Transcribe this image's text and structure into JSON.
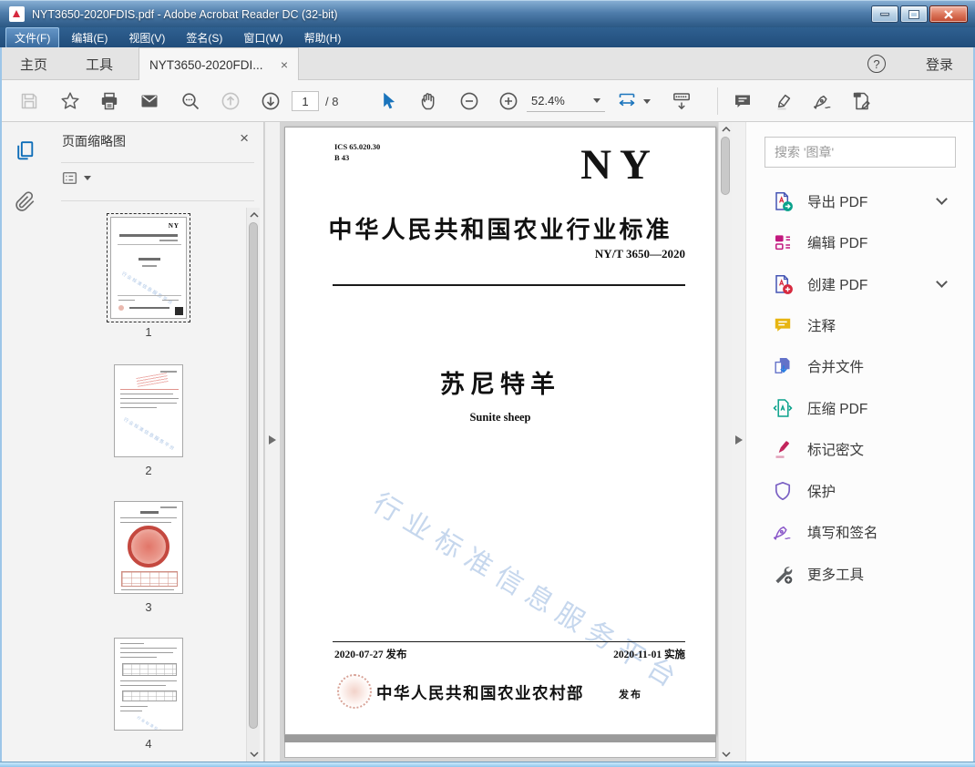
{
  "window": {
    "title": "NYT3650-2020FDIS.pdf - Adobe Acrobat Reader DC (32-bit)"
  },
  "menu": {
    "items": [
      "文件(F)",
      "编辑(E)",
      "视图(V)",
      "签名(S)",
      "窗口(W)",
      "帮助(H)"
    ]
  },
  "tabbar": {
    "home": "主页",
    "tools": "工具",
    "document_tab": "NYT3650-2020FDI...",
    "close_tab": "×",
    "help": "?",
    "sign_in": "登录"
  },
  "toolbar": {
    "page_current": "1",
    "page_total": "/ 8",
    "zoom_value": "52.4%"
  },
  "left_panel": {
    "title": "页面缩略图",
    "close": "×",
    "thumbnails": [
      {
        "number": "1"
      },
      {
        "number": "2"
      },
      {
        "number": "3"
      },
      {
        "number": "4"
      }
    ]
  },
  "document": {
    "ics_line1": "ICS 65.020.30",
    "ics_line2": "B 43",
    "logo": "NY",
    "standard_title": "中华人民共和国农业行业标准",
    "standard_number": "NY/T 3650—2020",
    "doc_title_cn": "苏尼特羊",
    "doc_title_en": "Sunite sheep",
    "watermark": "行业标准信息服务平台",
    "issue_date": "2020-07-27 发布",
    "implement_date": "2020-11-01 实施",
    "publisher": "中华人民共和国农业农村部",
    "publish_suffix": "发布"
  },
  "right_panel": {
    "search_placeholder": "搜索 '图章'",
    "tools": [
      {
        "label": "导出 PDF",
        "expandable": true
      },
      {
        "label": "编辑 PDF",
        "expandable": false
      },
      {
        "label": "创建 PDF",
        "expandable": true
      },
      {
        "label": "注释",
        "expandable": false
      },
      {
        "label": "合并文件",
        "expandable": false
      },
      {
        "label": "压缩 PDF",
        "expandable": false
      },
      {
        "label": "标记密文",
        "expandable": false
      },
      {
        "label": "保护",
        "expandable": false
      },
      {
        "label": "填写和签名",
        "expandable": false
      },
      {
        "label": "更多工具",
        "expandable": false
      }
    ]
  },
  "colors": {
    "accent_blue": "#1a74bc",
    "titlebar_blue": "#3b6ea2",
    "watermark_blue": "#bdd1eb",
    "seal_red": "#c0392f",
    "export_badge_teal": "#0aa18b",
    "edit_magenta": "#c2187e",
    "comment_yellow": "#e7b512",
    "protect_purple": "#7b61c4"
  }
}
